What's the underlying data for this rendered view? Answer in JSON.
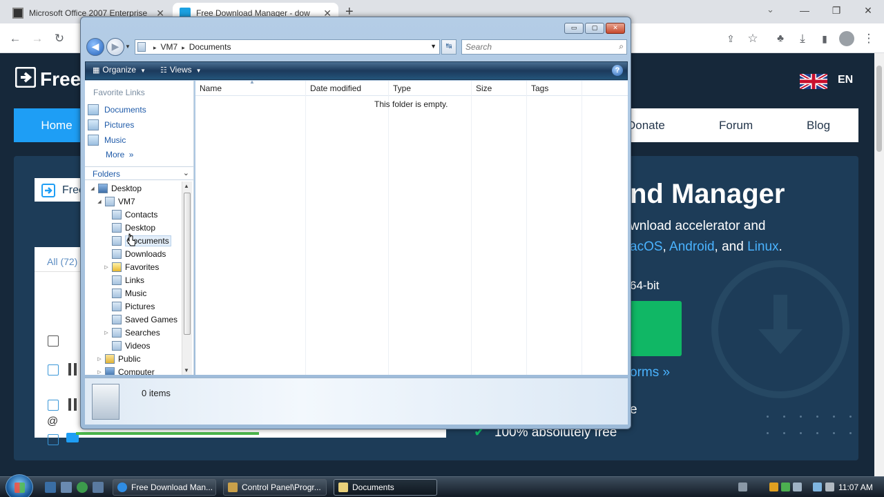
{
  "browser": {
    "tabs": [
      {
        "title": "Microsoft Office 2007 Enterprise",
        "active": false
      },
      {
        "title": "Free Download Manager - dow",
        "active": true
      }
    ],
    "new_tab": "+",
    "window_controls": {
      "minimize": "—",
      "restore": "❐",
      "close": "✕"
    },
    "toolbar": {
      "back": "←",
      "forward": "→",
      "reload": "↻"
    }
  },
  "website": {
    "logo_text": "Free",
    "language": "EN",
    "nav": {
      "home": "Home",
      "donate": "Donate",
      "forum": "Forum",
      "blog": "Blog"
    },
    "hero": {
      "title_partial": "nd Manager",
      "line1": "wnload accelerator and",
      "line2_prefix": "acOS",
      "line2_sep": ", ",
      "line2_android": "Android",
      "line2_and": ", and ",
      "line2_linux": "Linux",
      "line2_end": ".",
      "line3": "64-bit",
      "platforms": "orms",
      "platforms_arrow": "»",
      "line_e": "e",
      "free_text": "100% absolutely free",
      "check": "✔"
    },
    "app_mock": {
      "title": "Free",
      "all_label": "All (72)"
    }
  },
  "explorer": {
    "window_buttons": {
      "minimize": "▭",
      "maximize": "▢",
      "close": "✕"
    },
    "address": {
      "root_sep": "▸",
      "crumbs": [
        "VM7",
        "Documents"
      ],
      "sep": "▸",
      "dropdown": "▼"
    },
    "refresh": "↹",
    "search": {
      "placeholder": "Search",
      "icon": "⌕"
    },
    "commands": {
      "organize": "Organize",
      "views": "Views",
      "help": "?"
    },
    "favorite_links_header": "Favorite Links",
    "favorite_links": [
      "Documents",
      "Pictures",
      "Music"
    ],
    "more": "More",
    "more_chevron": "»",
    "folders_header": "Folders",
    "folders_chevron": "⌄",
    "tree": [
      {
        "label": "Desktop",
        "level": 0,
        "twisty": "◢"
      },
      {
        "label": "VM7",
        "level": 1,
        "twisty": "◢"
      },
      {
        "label": "Contacts",
        "level": 2,
        "twisty": ""
      },
      {
        "label": "Desktop",
        "level": 2,
        "twisty": ""
      },
      {
        "label": "Documents",
        "level": 2,
        "twisty": "",
        "selected": true
      },
      {
        "label": "Downloads",
        "level": 2,
        "twisty": ""
      },
      {
        "label": "Favorites",
        "level": 2,
        "twisty": "▷"
      },
      {
        "label": "Links",
        "level": 2,
        "twisty": ""
      },
      {
        "label": "Music",
        "level": 2,
        "twisty": ""
      },
      {
        "label": "Pictures",
        "level": 2,
        "twisty": ""
      },
      {
        "label": "Saved Games",
        "level": 2,
        "twisty": ""
      },
      {
        "label": "Searches",
        "level": 2,
        "twisty": "▷"
      },
      {
        "label": "Videos",
        "level": 2,
        "twisty": ""
      },
      {
        "label": "Public",
        "level": 1,
        "twisty": "▷"
      },
      {
        "label": "Computer",
        "level": 1,
        "twisty": "▷"
      }
    ],
    "columns": [
      "Name",
      "Date modified",
      "Type",
      "Size",
      "Tags"
    ],
    "sort_indicator": "▲",
    "empty_message": "This folder is empty.",
    "item_count": "0 items"
  },
  "taskbar": {
    "tasks": [
      {
        "label": "Free Download Man...",
        "active": false,
        "color": "#2f8de4"
      },
      {
        "label": "Control Panel\\Progr...",
        "active": false,
        "color": "#c9a04a"
      },
      {
        "label": "Documents",
        "active": true,
        "color": "#e8d07a"
      }
    ],
    "clock": "11:07 AM"
  }
}
